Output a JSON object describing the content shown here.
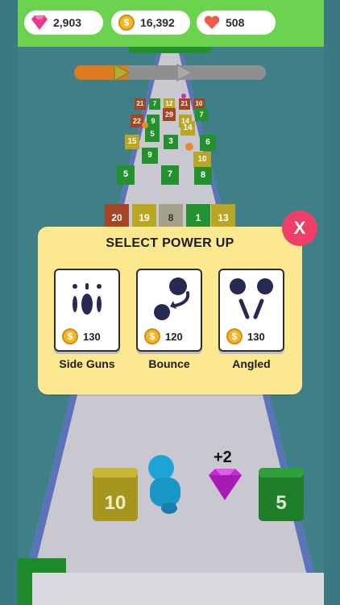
{
  "hud": {
    "gems": "2,903",
    "coins": "16,392",
    "lives": "508",
    "coin_symbol": "$"
  },
  "level_progress": 0.28,
  "blocks": {
    "far_rows": [
      [
        "21",
        "7",
        "12",
        "21",
        "10"
      ],
      [
        "22",
        "9",
        "29",
        "14",
        "7"
      ],
      [
        "15",
        "5",
        "14"
      ],
      [
        "9",
        "3",
        "6"
      ],
      [
        "10"
      ],
      [
        "5",
        "7",
        "8"
      ]
    ],
    "front_row": [
      "20",
      "19",
      "8",
      "1",
      "13"
    ],
    "near_left": "10",
    "near_right": "5",
    "gem_bonus": "+2"
  },
  "popup": {
    "title": "SELECT POWER UP",
    "close_label": "X",
    "options": [
      {
        "name": "Side Guns",
        "price": "130",
        "icon": "side-guns-icon"
      },
      {
        "name": "Bounce",
        "price": "120",
        "icon": "bounce-icon"
      },
      {
        "name": "Angled",
        "price": "130",
        "icon": "angled-icon"
      }
    ]
  },
  "colors": {
    "hud_green": "#6bd34f",
    "popup_bg": "#fbe88f",
    "close_button": "#ef3f69",
    "road": "#c7c6cf",
    "block_green": "#23922e",
    "block_yellow": "#b9a623",
    "block_red": "#a54522",
    "gem": "#c927d8",
    "player": "#1ea5d6"
  }
}
